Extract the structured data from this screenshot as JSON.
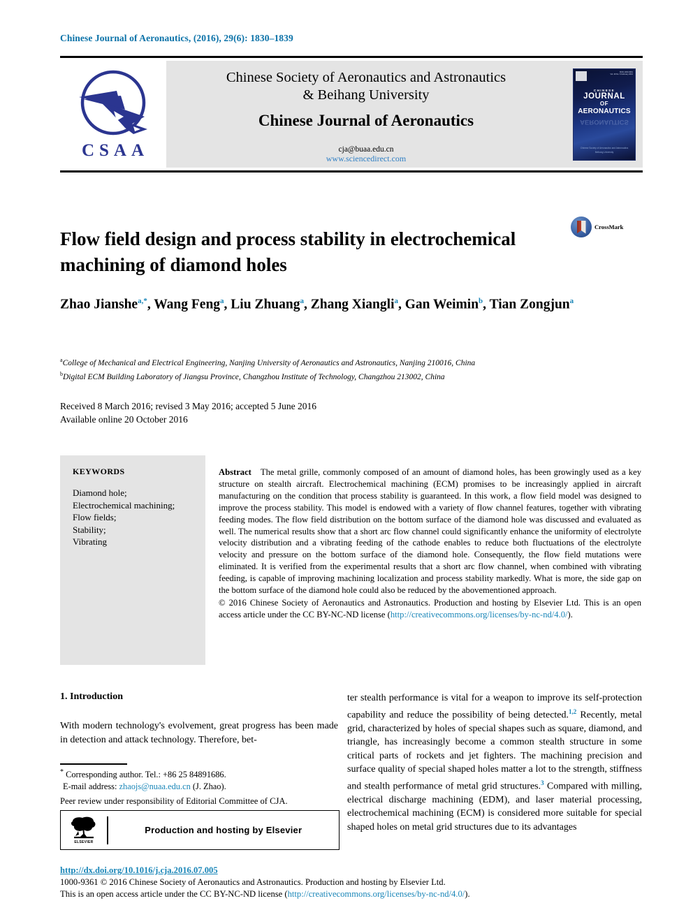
{
  "running_head": "Chinese Journal of Aeronautics, (2016), 29(6): 1830–1839",
  "masthead": {
    "society_line1": "Chinese Society of Aeronautics and Astronautics",
    "society_line2": "& Beihang University",
    "journal_name": "Chinese Journal of Aeronautics",
    "email": "cja@buaa.edu.cn",
    "website": "www.sciencedirect.com",
    "logo_word": "CSAA",
    "cover": {
      "chinese_label": "CHINESE",
      "line_journal": "JOURNAL",
      "line_of": "OF",
      "line_aeronautics": "AERONAUTICS",
      "issn_block": "ISSN 1000-9361\nVol. 29 No. 6 February 2016",
      "footer_line1": "Chinese Society of Aeronautics and Astronautics",
      "footer_line2": "Beihang University"
    }
  },
  "article": {
    "title": "Flow field design and process stability in electrochemical machining of diamond holes",
    "crossmark_label": "CrossMark",
    "authors": [
      {
        "name": "Zhao Jianshe",
        "sup": "a,*"
      },
      {
        "name": "Wang Feng",
        "sup": "a"
      },
      {
        "name": "Liu Zhuang",
        "sup": "a"
      },
      {
        "name": "Zhang Xiangli",
        "sup": "a"
      },
      {
        "name": "Gan Weimin",
        "sup": "b"
      },
      {
        "name": "Tian Zongjun",
        "sup": "a"
      }
    ],
    "affiliations": [
      {
        "marker": "a",
        "text": "College of Mechanical and Electrical Engineering, Nanjing University of Aeronautics and Astronautics, Nanjing 210016, China"
      },
      {
        "marker": "b",
        "text": "Digital ECM Building Laboratory of Jiangsu Province, Changzhou Institute of Technology, Changzhou 213002, China"
      }
    ],
    "dates_line1": "Received 8 March 2016; revised 3 May 2016; accepted 5 June 2016",
    "dates_line2": "Available online 20 October 2016"
  },
  "keywords": {
    "heading": "KEYWORDS",
    "items": [
      "Diamond hole;",
      "Electrochemical machining;",
      "Flow fields;",
      "Stability;",
      "Vibrating"
    ]
  },
  "abstract": {
    "label": "Abstract",
    "body": "The metal grille, commonly composed of an amount of diamond holes, has been growingly used as a key structure on stealth aircraft. Electrochemical machining (ECM) promises to be increasingly applied in aircraft manufacturing on the condition that process stability is guaranteed. In this work, a flow field model was designed to improve the process stability. This model is endowed with a variety of flow channel features, together with vibrating feeding modes. The flow field distribution on the bottom surface of the diamond hole was discussed and evaluated as well. The numerical results show that a short arc flow channel could significantly enhance the uniformity of electrolyte velocity distribution and a vibrating feeding of the cathode enables to reduce both fluctuations of the electrolyte velocity and pressure on the bottom surface of the diamond hole. Consequently, the flow field mutations were eliminated. It is verified from the experimental results that a short arc flow channel, when combined with vibrating feeding, is capable of improving machining localization and process stability markedly. What is more, the side gap on the bottom surface of the diamond hole could also be reduced by the abovementioned approach.",
    "copyright_pre": "© 2016 Chinese Society of Aeronautics and Astronautics. Production and hosting by Elsevier Ltd. This is an open access article under the CC BY-NC-ND license (",
    "license_url": "http://creativecommons.org/licenses/by-nc-nd/4.0/",
    "copyright_post": ")."
  },
  "section": {
    "heading": "1. Introduction",
    "left_paragraph": "With modern technology's evolvement, great progress has been made in detection and attack technology. Therefore, bet-",
    "right_part1": "ter stealth performance is vital for a weapon to improve its self-protection capability and reduce the possibility of being detected.",
    "right_cite1": "1,2",
    "right_part2": " Recently, metal grid, characterized by holes of special shapes such as square, diamond, and triangle, has increasingly become a common stealth structure in some critical parts of rockets and jet fighters. The machining precision and surface quality of special shaped holes matter a lot to the strength, stiffness and stealth performance of metal grid structures.",
    "right_cite2": "3",
    "right_part3": " Compared with milling, electrical discharge machining (EDM), and laser material processing, electrochemical machining (ECM) is considered more suitable for special shaped holes on metal grid structures due to its advantages"
  },
  "footnote": {
    "corresponding_marker": "*",
    "corresponding": " Corresponding author. Tel.: +86 25 84891686.",
    "email_label": "E-mail address:",
    "email": "zhaojs@nuaa.edu.cn",
    "email_suffix": "(J. Zhao).",
    "peer_review": "Peer review under responsibility of Editorial Committee of CJA."
  },
  "elsevier_box": {
    "label": "Production and hosting by Elsevier",
    "logo_word": "ELSEVIER"
  },
  "footer": {
    "doi": "http://dx.doi.org/10.1016/j.cja.2016.07.005",
    "issn_line": "1000-9361 © 2016 Chinese Society of Aeronautics and Astronautics. Production and hosting by Elsevier Ltd.",
    "license_pre": "This is an open access article under the CC BY-NC-ND license (",
    "license_url": "http://creativecommons.org/licenses/by-nc-nd/4.0/",
    "license_post": ")."
  },
  "colors": {
    "link_blue": "#1a86b8",
    "head_blue": "#0b72a8",
    "logo_blue": "#2b3590",
    "band_gray": "#e4e4e4"
  }
}
